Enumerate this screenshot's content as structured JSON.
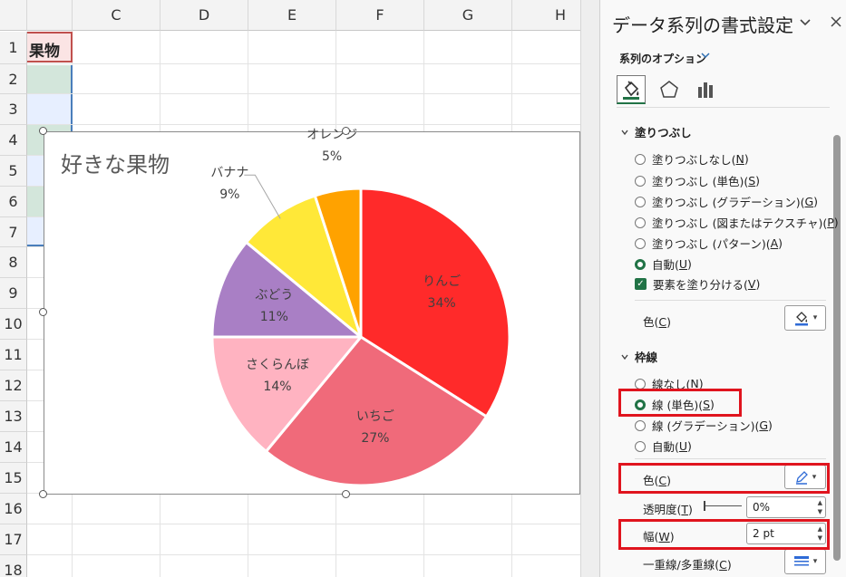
{
  "sheet": {
    "columns": [
      "C",
      "D",
      "E",
      "F",
      "G",
      "H"
    ],
    "rows": [
      "1",
      "2",
      "3",
      "4",
      "5",
      "6",
      "7",
      "8",
      "9",
      "10",
      "11",
      "12",
      "13",
      "14",
      "15",
      "16",
      "17",
      "18"
    ],
    "cell_b1": "果物"
  },
  "chart": {
    "title": "好きな果物"
  },
  "chart_data": {
    "type": "pie",
    "title": "好きな果物",
    "categories": [
      "りんご",
      "いちご",
      "さくらんぼ",
      "ぶどう",
      "バナナ",
      "オレンジ"
    ],
    "values": [
      34,
      27,
      14,
      11,
      9,
      5
    ],
    "percent_labels": [
      "34%",
      "27%",
      "14%",
      "11%",
      "9%",
      "5%"
    ],
    "colors": [
      "#ff2a2a",
      "#f06a7a",
      "#ffb3c1",
      "#a97fc5",
      "#ffe838",
      "#ffa200"
    ],
    "start_angle_deg": 0,
    "direction": "clockwise",
    "slice_border": "#ffffff",
    "legend": "none"
  },
  "pane": {
    "title": "データ系列の書式設定",
    "options_label": "系列のオプション",
    "fill_section": "塗りつぶし",
    "fill_options": [
      {
        "label": "塗りつぶしなし(",
        "key": "N",
        "selected": false
      },
      {
        "label": "塗りつぶし (単色)(",
        "key": "S",
        "selected": false
      },
      {
        "label": "塗りつぶし (グラデーション)(",
        "key": "G",
        "selected": false
      },
      {
        "label": "塗りつぶし (図またはテクスチャ)(",
        "key": "P",
        "selected": false
      },
      {
        "label": "塗りつぶし (パターン)(",
        "key": "A",
        "selected": false
      },
      {
        "label": "自動(",
        "key": "U",
        "selected": true
      }
    ],
    "vary_colors": {
      "label": "要素を塗り分ける(",
      "key": "V",
      "checked": true
    },
    "fill_color_label": "色(",
    "fill_color_key": "C",
    "line_section": "枠線",
    "line_options": [
      {
        "label": "線なし(",
        "key": "N",
        "selected": false
      },
      {
        "label": "線 (単色)(",
        "key": "S",
        "selected": true
      },
      {
        "label": "線 (グラデーション)(",
        "key": "G",
        "selected": false
      },
      {
        "label": "自動(",
        "key": "U",
        "selected": false
      }
    ],
    "line_color_label": "色(",
    "line_color_key": "C",
    "transparency_label": "透明度(",
    "transparency_key": "T",
    "transparency_value": "0%",
    "width_label": "幅(",
    "width_key": "W",
    "width_value": "2 pt",
    "compound_label": "一重線/多重線(",
    "compound_key": "C",
    "close_paren": ")"
  }
}
